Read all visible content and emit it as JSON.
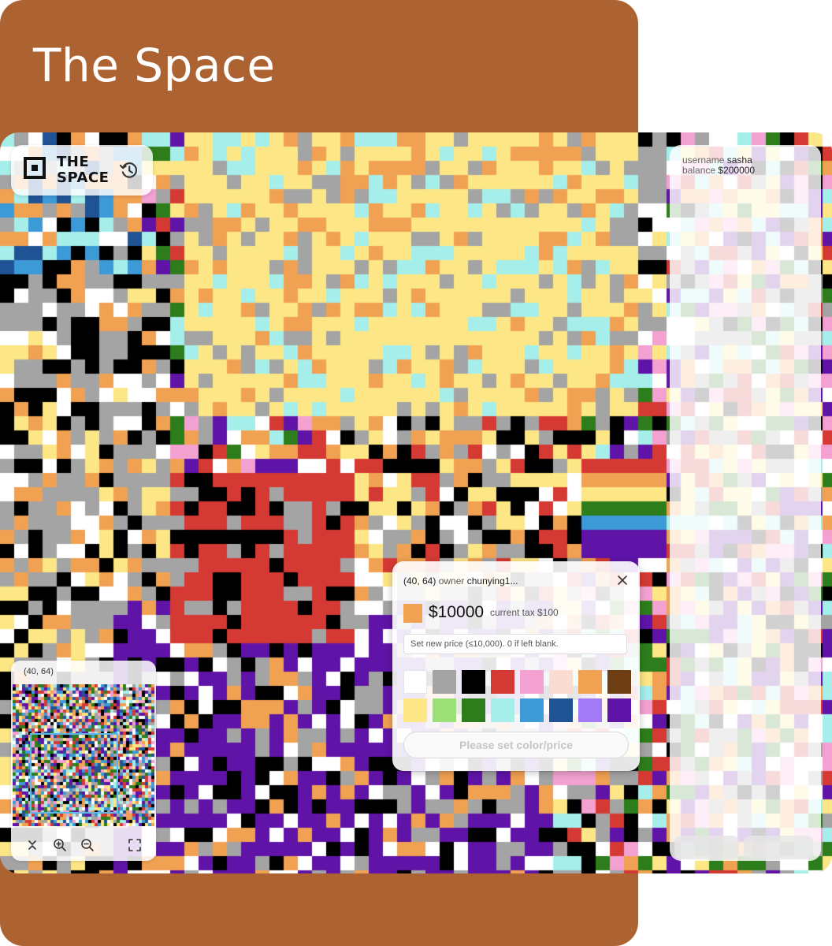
{
  "title": "The Space",
  "logo": {
    "line1": "THE",
    "line2": "SPACE"
  },
  "account": {
    "username_label": "username",
    "username": "sasha",
    "balance_label": "balance",
    "balance": "$200000"
  },
  "pixel_popup": {
    "coords": "(40, 64)",
    "owner_label": "owner",
    "owner": "chunying1...",
    "price": "$10000",
    "tax_text": "current tax $100",
    "price_placeholder": "Set new price (≤10,000). 0 if left blank.",
    "current_color": "#f1a152",
    "palette": [
      "#ffffff",
      "#a4a4a4",
      "#000000",
      "#d43a33",
      "#f2a1d0",
      "#fadcd3",
      "#f1a152",
      "#6d3d14",
      "#fde685",
      "#9ae076",
      "#2e7d1c",
      "#a6eeea",
      "#3c9ad7",
      "#205394",
      "#a27af6",
      "#5f14a7"
    ],
    "button": "Please set color/price"
  },
  "minimap": {
    "coords": "(40, 64)"
  },
  "icons": [
    "history-icon",
    "close-icon",
    "collapse-icon",
    "zoom-in-icon",
    "zoom-out-icon",
    "fullscreen-icon"
  ]
}
